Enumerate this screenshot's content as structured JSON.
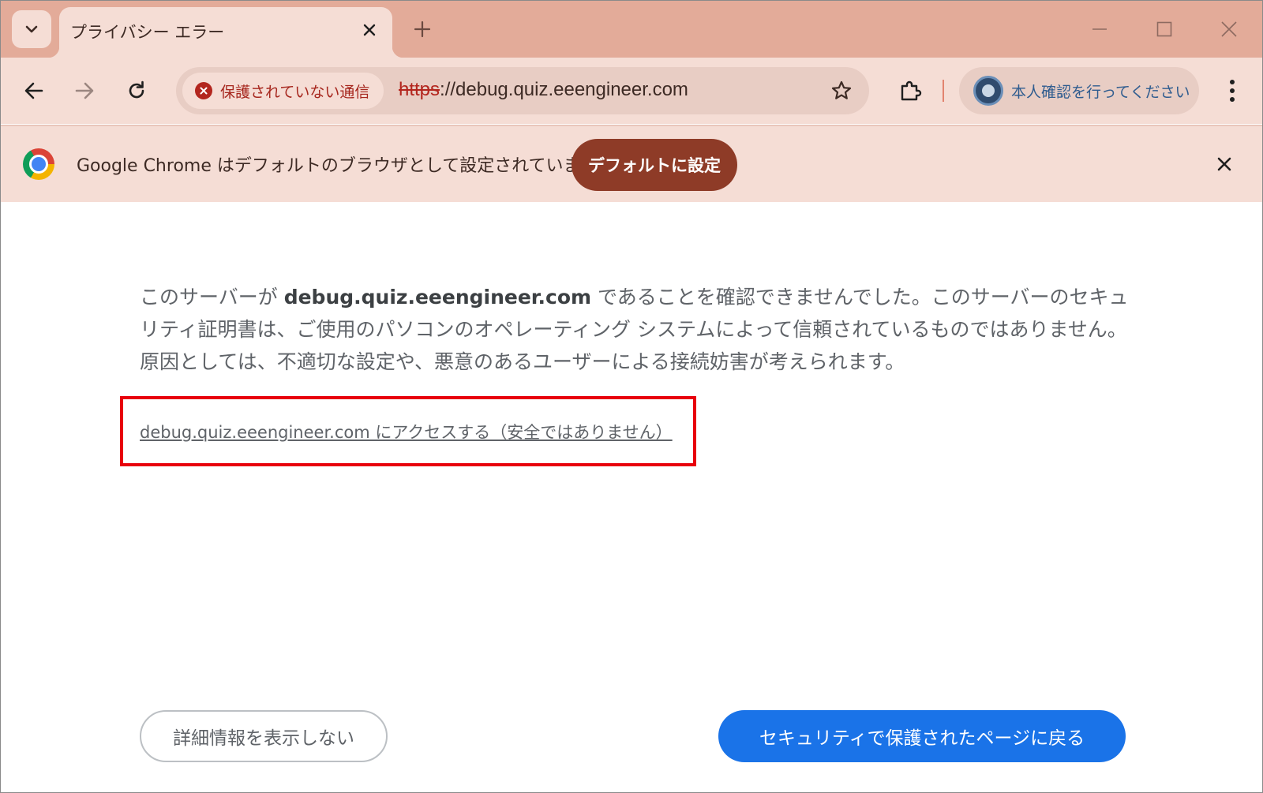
{
  "browser": {
    "tab": {
      "title": "プライバシー エラー"
    },
    "toolbar": {
      "security_chip_label": "保護されていない通信",
      "url_scheme": "https",
      "url_rest": "://debug.quiz.eeengineer.com",
      "profile_label": "本人確認を行ってください"
    },
    "infobar": {
      "message": "Google Chrome はデフォルトのブラウザとして設定されていません",
      "button_label": "デフォルトに設定"
    }
  },
  "page": {
    "paragraph": {
      "before": "このサーバーが ",
      "domain": "debug.quiz.eeengineer.com",
      "after": " であることを確認できませんでした。このサーバーのセキュリティ証明書は、ご使用のパソコンのオペレーティング システムによって信頼されているものではありません。原因としては、不適切な設定や、悪意のあるユーザーによる接続妨害が考えられます。"
    },
    "proceed_link": "debug.quiz.eeengineer.com にアクセスする（安全ではありません）",
    "hide_details_button": "詳細情報を表示しない",
    "back_button": "セキュリティで保護されたページに戻る"
  },
  "colors": {
    "tabstrip_bg": "#e3ab99",
    "toolbar_bg": "#f5ddd5",
    "security_red": "#b3261e",
    "default_button_bg": "#8e3b27",
    "primary_blue": "#1a73e8",
    "highlight_red": "#e8000b"
  }
}
